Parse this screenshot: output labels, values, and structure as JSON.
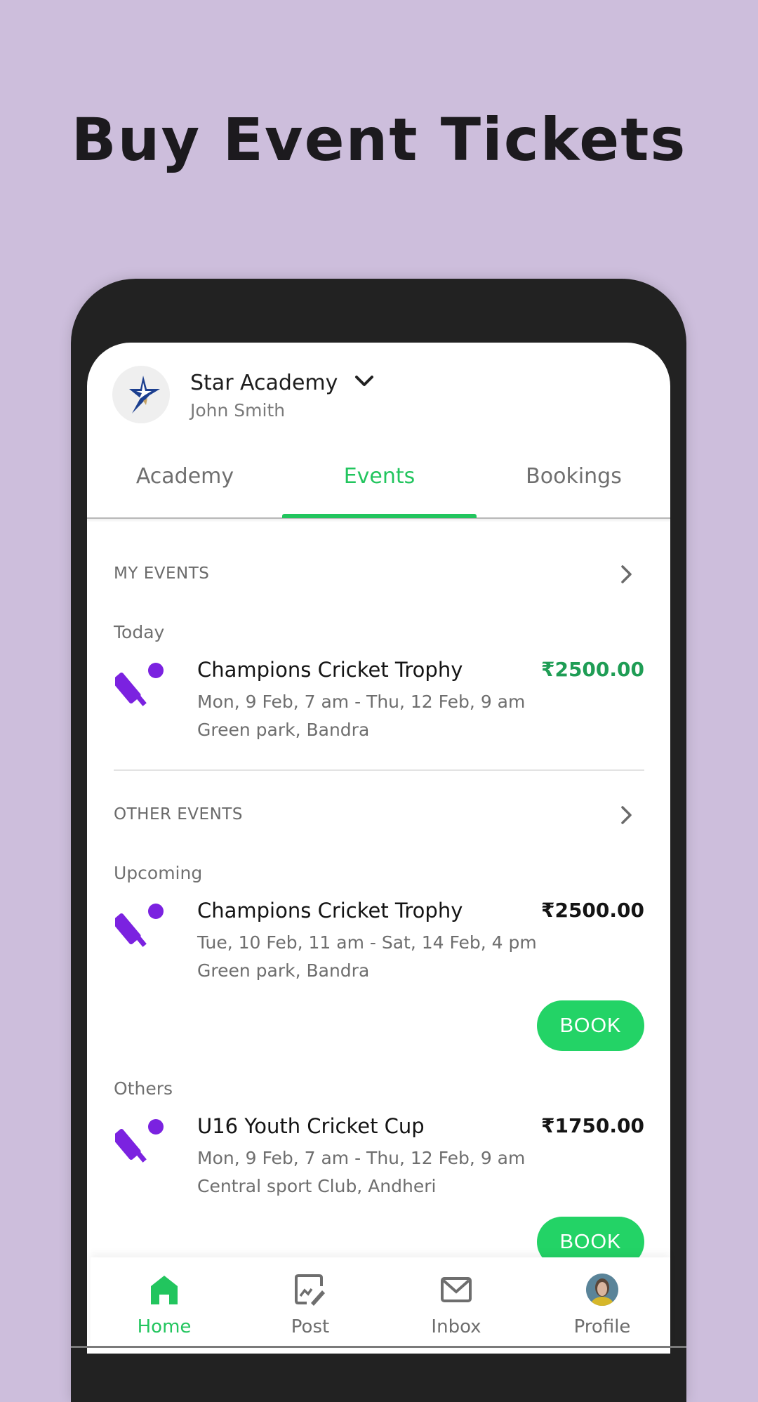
{
  "headline": "Buy Event Tickets",
  "colors": {
    "background": "#cdbedc",
    "accent_green": "#22c55e",
    "price_green": "#1f9d55",
    "book_button": "#23d366",
    "event_icon_purple": "#7b22e0",
    "frame": "#222222"
  },
  "header": {
    "logo_icon": "star-logo-icon",
    "org_name": "Star Academy",
    "dropdown_icon": "chevron-down-icon",
    "user_name": "John Smith"
  },
  "tabs": [
    {
      "label": "Academy",
      "active": false
    },
    {
      "label": "Events",
      "active": true
    },
    {
      "label": "Bookings",
      "active": false
    }
  ],
  "sections": {
    "my_events": {
      "title": "MY EVENTS",
      "arrow_icon": "chevron-right-icon",
      "groups": [
        {
          "label": "Today",
          "events": [
            {
              "icon": "cricket-icon",
              "title": "Champions Cricket Trophy",
              "price": "₹2500.00",
              "dates": "Mon, 9 Feb, 7 am - Thu, 12 Feb, 9 am",
              "location": "Green park, Bandra"
            }
          ]
        }
      ]
    },
    "other_events": {
      "title": "OTHER EVENTS",
      "arrow_icon": "chevron-right-icon",
      "groups": [
        {
          "label": "Upcoming",
          "events": [
            {
              "icon": "cricket-icon",
              "title": "Champions Cricket Trophy",
              "price": "₹2500.00",
              "dates": "Tue, 10 Feb, 11 am - Sat, 14 Feb, 4 pm",
              "location": "Green park, Bandra",
              "button": "BOOK"
            }
          ]
        },
        {
          "label": "Others",
          "events": [
            {
              "icon": "cricket-icon",
              "title": "U16 Youth Cricket Cup",
              "price": "₹1750.00",
              "dates": "Mon, 9 Feb, 7 am - Thu, 12 Feb, 9 am",
              "location": "Central sport Club, Andheri",
              "button": "BOOK"
            }
          ]
        }
      ]
    }
  },
  "bottom_nav": [
    {
      "label": "Home",
      "icon": "home-icon",
      "active": true
    },
    {
      "label": "Post",
      "icon": "post-edit-icon",
      "active": false
    },
    {
      "label": "Inbox",
      "icon": "mail-icon",
      "active": false
    },
    {
      "label": "Profile",
      "icon": "profile-avatar",
      "active": false
    }
  ]
}
